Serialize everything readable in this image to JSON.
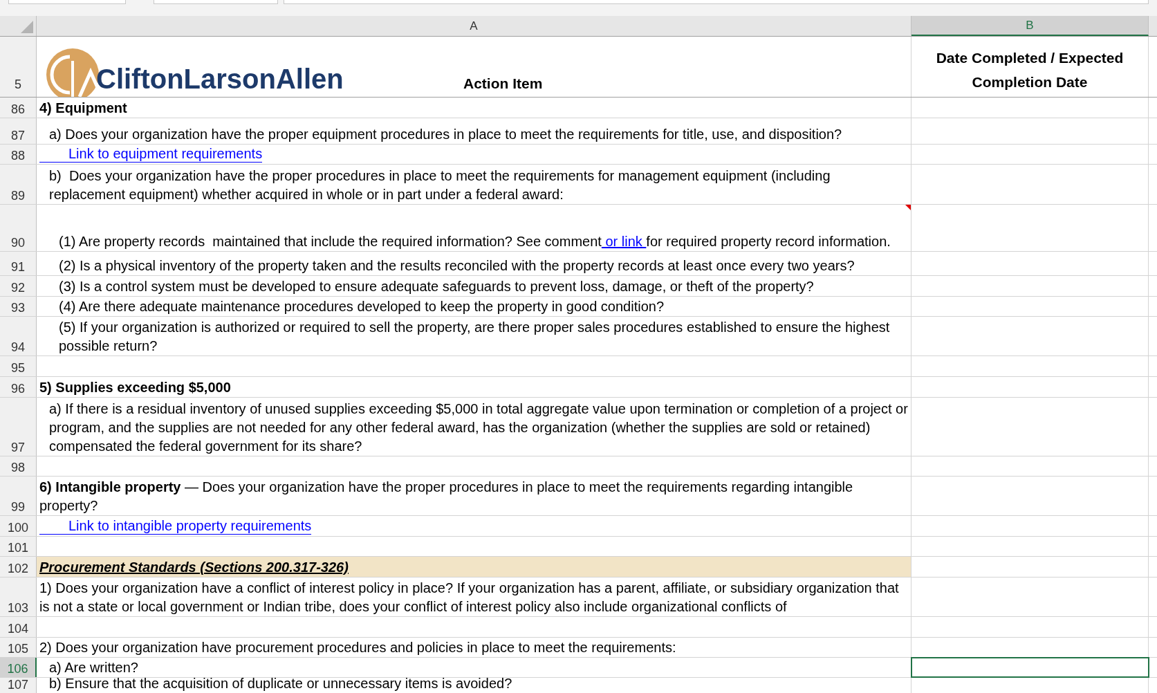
{
  "columns": [
    {
      "label": "A",
      "selected": false
    },
    {
      "label": "B",
      "selected": true
    }
  ],
  "header_row": {
    "number": "5",
    "logo_text": "CliftonLarsonAllen",
    "column_a": "Action Item",
    "column_b": "Date Completed / Expected Completion Date"
  },
  "rows": [
    {
      "number": "86",
      "kind": "heading",
      "text": "4) Equipment",
      "selected": false
    },
    {
      "number": "87",
      "kind": "question",
      "text": "a) Does your organization have the proper equipment procedures in place to meet the requirements for title, use, and disposition?",
      "selected": false
    },
    {
      "number": "88",
      "kind": "link",
      "text": "Link to equipment requirements",
      "selected": false
    },
    {
      "number": "89",
      "kind": "question",
      "text": "b)  Does your organization have the proper procedures in place to meet the requirements for management equipment (including replacement equipment) whether acquired in whole or in part under a federal award:",
      "selected": false
    },
    {
      "number": "90",
      "kind": "subquestion_link",
      "text": "(1) Are property records  maintained that include the required information? See comment",
      "link": " or link ",
      "text_after": "for required property record information.",
      "comment": true,
      "selected": false
    },
    {
      "number": "91",
      "kind": "subquestion",
      "text": "(2) Is a physical inventory of the property taken and the results reconciled with the property records at least once every two years?",
      "selected": false
    },
    {
      "number": "92",
      "kind": "subquestion",
      "text": "(3) Is a control system must be developed to ensure adequate safeguards to prevent loss, damage, or theft of the property?",
      "selected": false
    },
    {
      "number": "93",
      "kind": "subquestion",
      "text": "(4) Are there adequate maintenance procedures developed to keep the property in good condition?",
      "selected": false
    },
    {
      "number": "94",
      "kind": "subquestion",
      "text": "(5) If your organization is authorized or required to sell the property, are there proper sales procedures established to ensure the highest possible return?",
      "selected": false
    },
    {
      "number": "95",
      "kind": "empty",
      "selected": false
    },
    {
      "number": "96",
      "kind": "heading",
      "text": "5) Supplies exceeding $5,000",
      "selected": false
    },
    {
      "number": "97",
      "kind": "question",
      "text": "a) If there is a residual inventory of unused supplies exceeding $5,000 in total aggregate value upon termination or completion of a project or program, and the supplies are not needed for any other federal award, has the organization (whether the supplies are sold or retained) compensated the federal government for its share?",
      "selected": false
    },
    {
      "number": "98",
      "kind": "empty",
      "selected": false
    },
    {
      "number": "99",
      "kind": "plain",
      "text": "**6) Intangible property** — Does your organization have the proper procedures in place to meet the requirements regarding intangible property?",
      "selected": false
    },
    {
      "number": "100",
      "kind": "link",
      "text": "Link to intangible property requirements",
      "selected": false
    },
    {
      "number": "101",
      "kind": "empty",
      "selected": false
    },
    {
      "number": "102",
      "kind": "section",
      "text": "Procurement Standards (Sections 200.317-326)",
      "selected": false
    },
    {
      "number": "103",
      "kind": "plain",
      "text": "1) Does your organization have a conflict of interest policy in place? If your organization has a parent, affiliate, or subsidiary organization that is not a state or local government or Indian tribe, does your conflict of interest policy also include organizational conflicts of",
      "selected": false
    },
    {
      "number": "104",
      "kind": "empty",
      "selected": false
    },
    {
      "number": "105",
      "kind": "plain",
      "text": "2) Does your organization have procurement procedures and policies in place to meet the requirements:",
      "selected": false
    },
    {
      "number": "106",
      "kind": "question",
      "text": "a) Are written?",
      "selected": true
    },
    {
      "number": "107",
      "kind": "question",
      "text": "b) Ensure that the acquisition of duplicate or unnecessary items is avoided?",
      "selected": false
    }
  ]
}
